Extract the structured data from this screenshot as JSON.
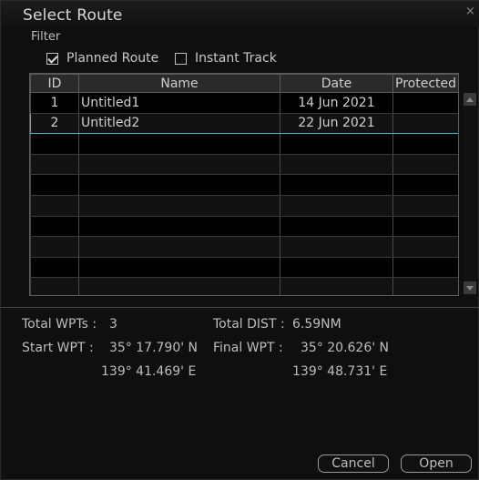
{
  "dialog": {
    "title": "Select Route",
    "close_glyph": "×"
  },
  "filter": {
    "label": "Filter",
    "options": [
      {
        "label": "Planned Route",
        "checked": true
      },
      {
        "label": "Instant Track",
        "checked": false
      }
    ]
  },
  "table": {
    "columns": [
      "ID",
      "Name",
      "Date",
      "Protected"
    ],
    "rows": [
      {
        "id": "1",
        "name": "Untitled1",
        "date": "14 Jun 2021",
        "protected": ""
      },
      {
        "id": "2",
        "name": "Untitled2",
        "date": "22 Jun 2021",
        "protected": ""
      }
    ],
    "selected_row": 2
  },
  "details": {
    "total_wpts_label": "Total WPTs :",
    "total_wpts_value": "3",
    "total_dist_label": "Total DIST :",
    "total_dist_value": "6.59NM",
    "start_wpt_label": "Start WPT :",
    "start_wpt_lat": "35° 17.790' N",
    "start_wpt_lon": "139° 41.469' E",
    "final_wpt_label": "Final WPT :",
    "final_wpt_lat": "35° 20.626' N",
    "final_wpt_lon": "139° 48.731' E"
  },
  "buttons": {
    "cancel": "Cancel",
    "open": "Open"
  },
  "colors": {
    "selection_border": "#4ab3c9",
    "background": "#0f0f0f"
  }
}
